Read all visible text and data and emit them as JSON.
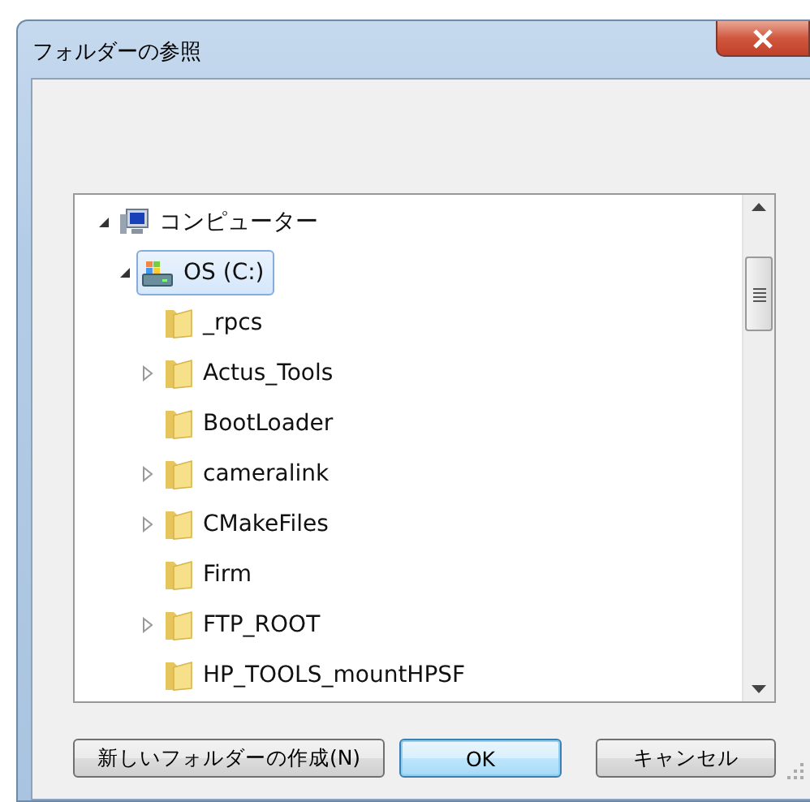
{
  "window": {
    "title": "フォルダーの参照"
  },
  "tree": [
    {
      "label": "コンピューター",
      "kind": "computer",
      "expanded": true,
      "selected": false,
      "children": [
        {
          "label": "OS (C:)",
          "kind": "drive",
          "expanded": true,
          "selected": true,
          "children": [
            {
              "label": "_rpcs",
              "kind": "folder",
              "has_children": false
            },
            {
              "label": "Actus_Tools",
              "kind": "folder",
              "has_children": true
            },
            {
              "label": "BootLoader",
              "kind": "folder",
              "has_children": false
            },
            {
              "label": "cameralink",
              "kind": "folder",
              "has_children": true
            },
            {
              "label": "CMakeFiles",
              "kind": "folder",
              "has_children": true
            },
            {
              "label": "Firm",
              "kind": "folder",
              "has_children": false
            },
            {
              "label": "FTP_ROOT",
              "kind": "folder",
              "has_children": true
            },
            {
              "label": "HP_TOOLS_mountHPSF",
              "kind": "folder",
              "has_children": false
            }
          ]
        }
      ]
    }
  ],
  "buttons": [
    {
      "label": "新しいフォルダーの作成(N)",
      "default": false
    },
    {
      "label": "OK",
      "default": true
    },
    {
      "label": "キャンセル",
      "default": false
    }
  ]
}
